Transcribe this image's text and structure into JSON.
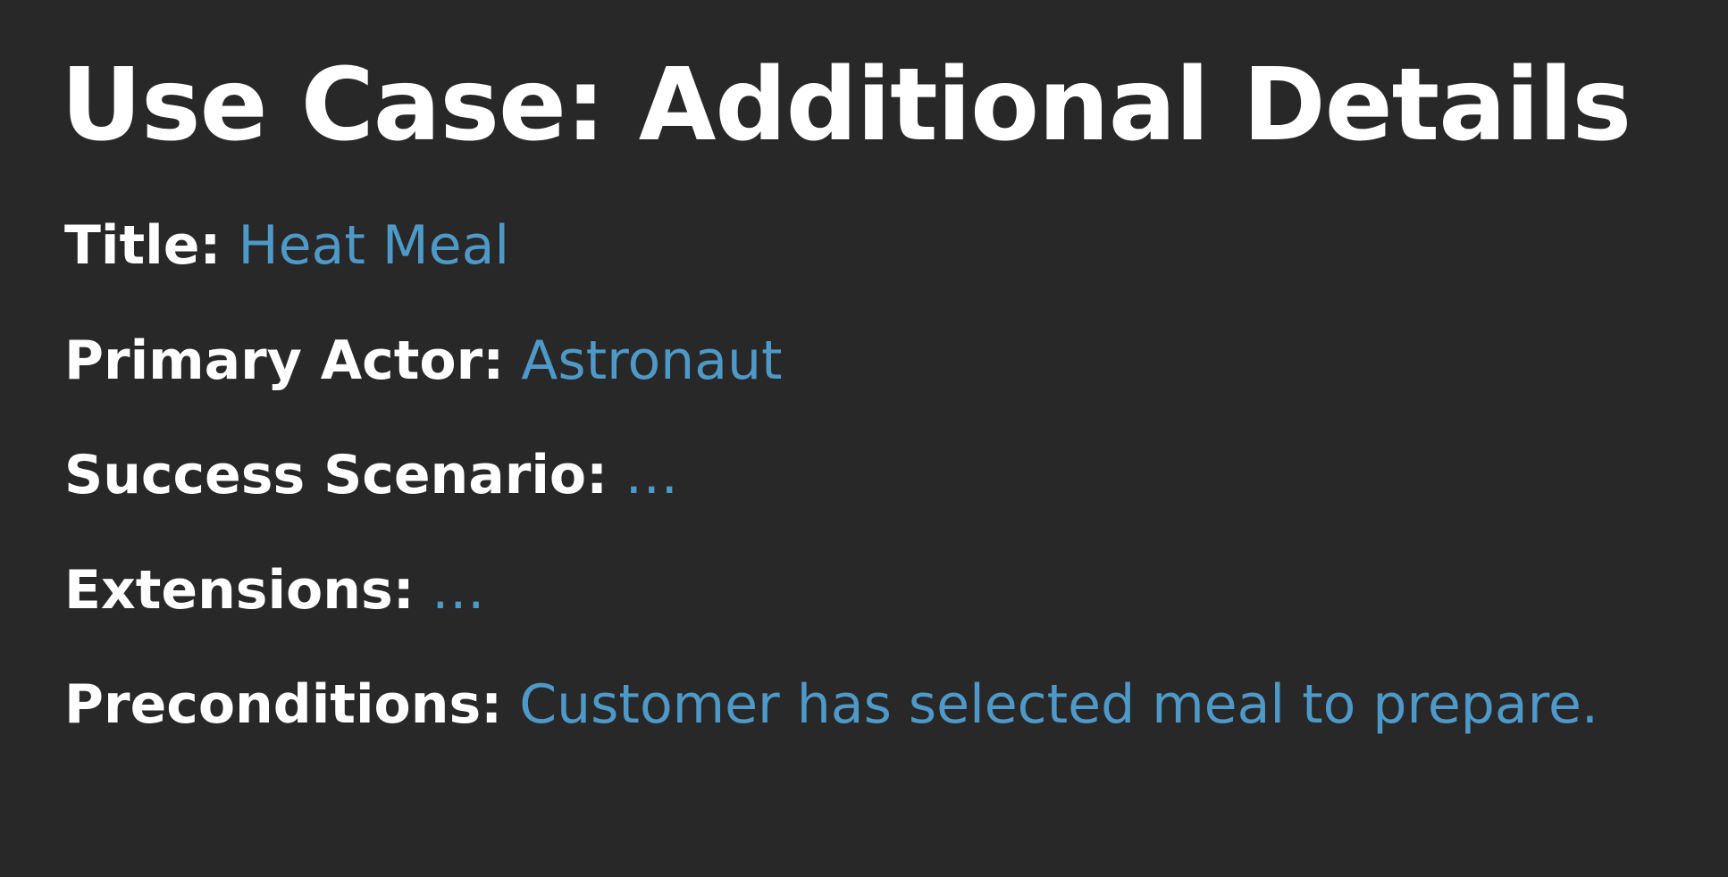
{
  "slide": {
    "title": "Use Case: Additional Details",
    "details": [
      {
        "label": "Title:",
        "value": "Heat Meal"
      },
      {
        "label": "Primary Actor:",
        "value": "Astronaut"
      },
      {
        "label": "Success Scenario:",
        "value": "…"
      },
      {
        "label": "Extensions:",
        "value": "…"
      },
      {
        "label": "Preconditions:",
        "value": "Customer has selected meal to prepare."
      }
    ]
  },
  "colors": {
    "background": "#282828",
    "label": "#ffffff",
    "value_accent": "#4e99c7"
  }
}
